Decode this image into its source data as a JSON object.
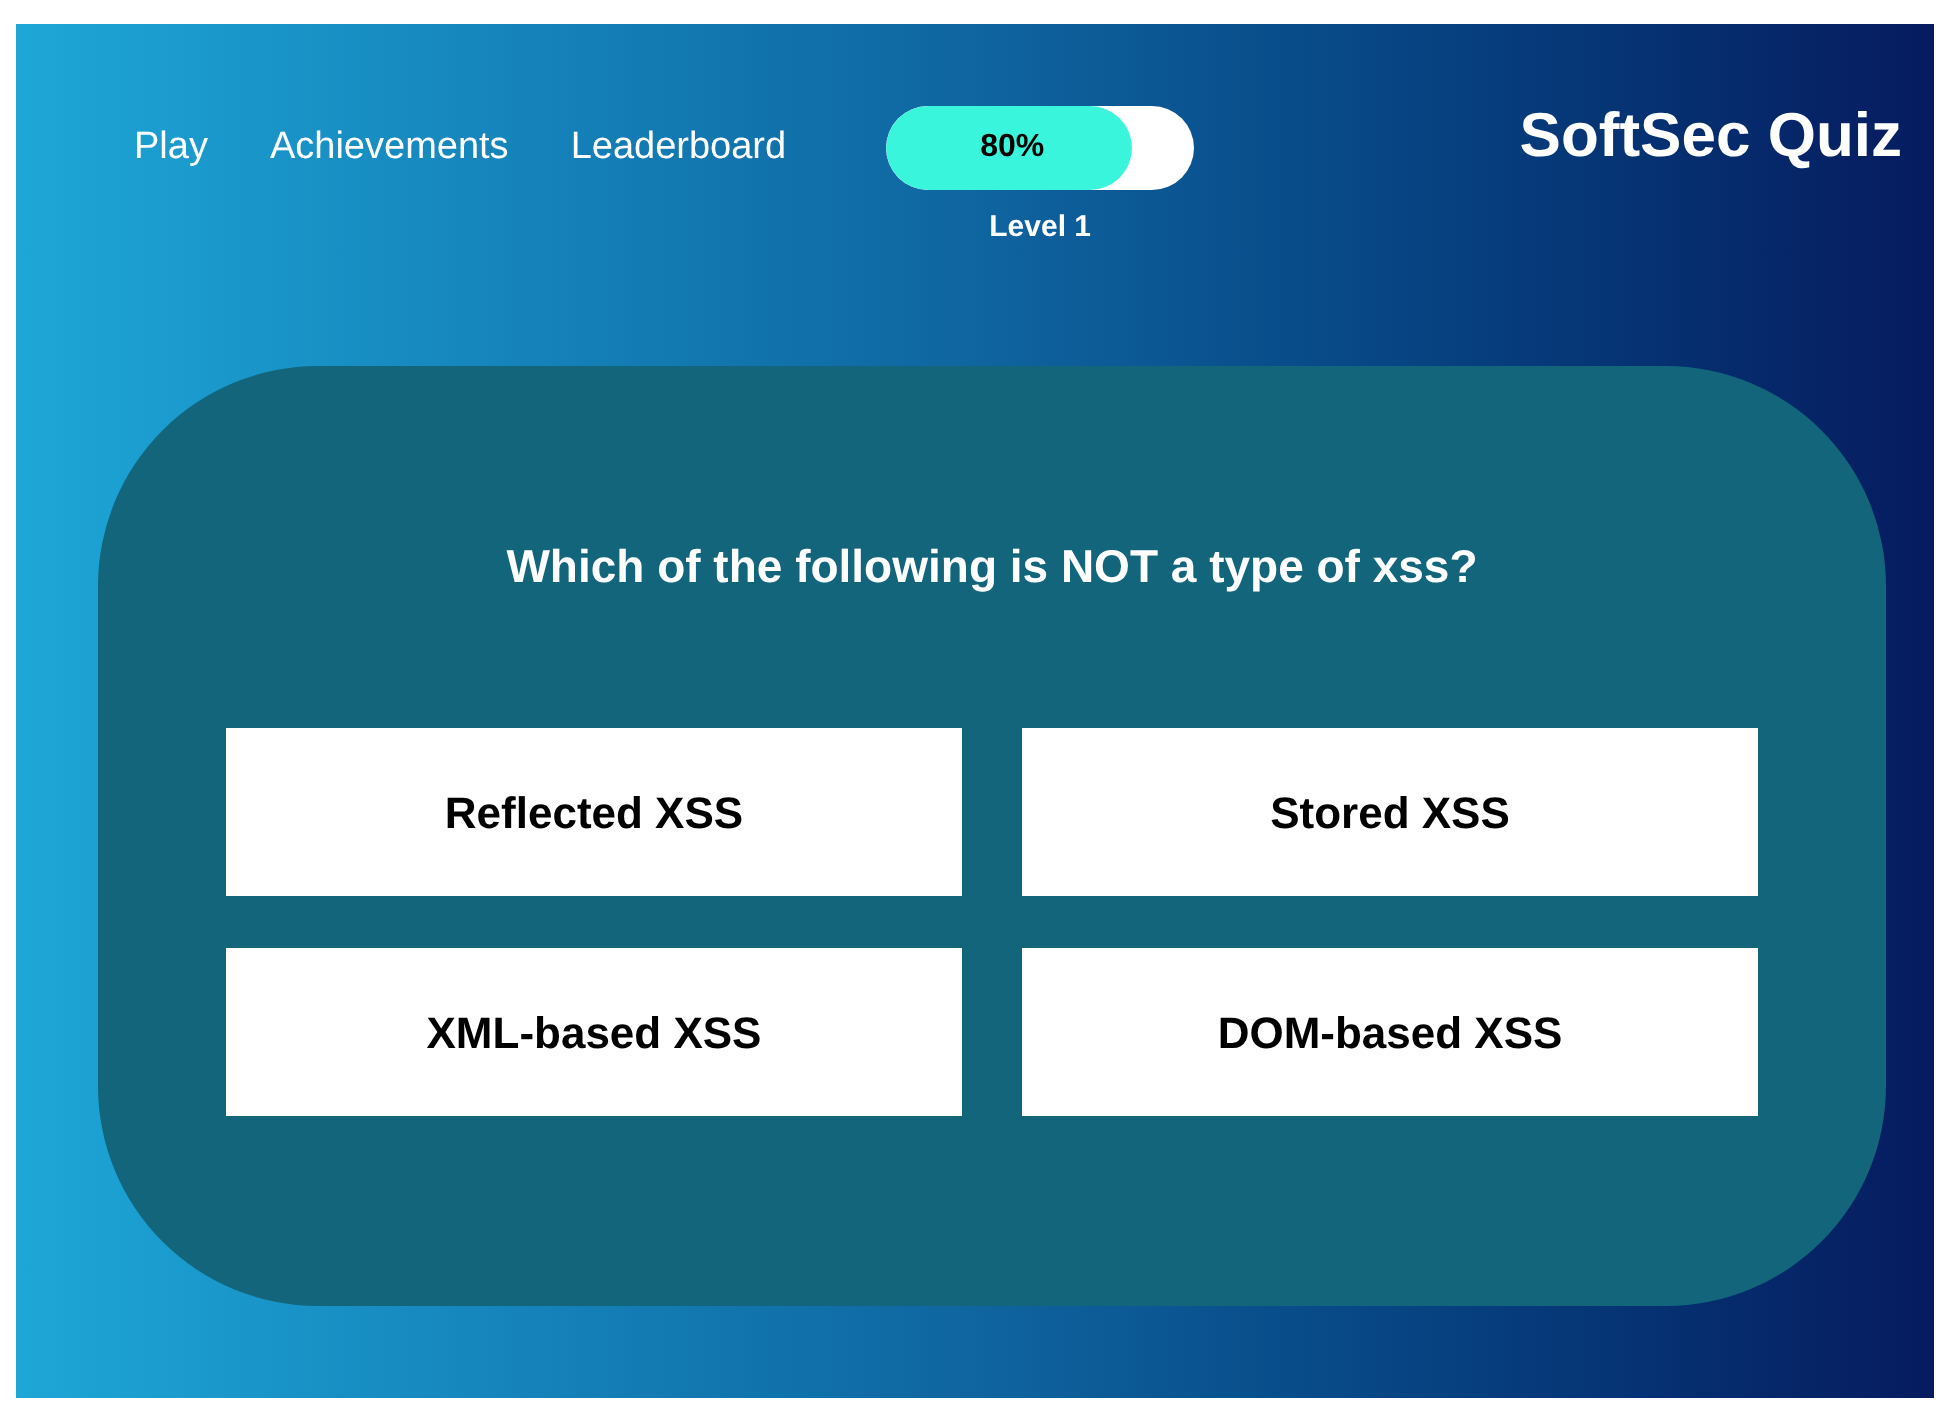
{
  "nav": [
    {
      "label": "Play"
    },
    {
      "label": "Achievements"
    },
    {
      "label": "Leaderboard"
    }
  ],
  "progress": {
    "label": "80%",
    "level": 0.8,
    "caption": "Level 1"
  },
  "title": "SoftSec Quiz",
  "question": "Which of the following is NOT a type of xss?",
  "answers": [
    {
      "label": "Reflected XSS"
    },
    {
      "label": "Stored XSS"
    },
    {
      "label": "XML-based XSS"
    },
    {
      "label": "DOM-based XSS"
    }
  ]
}
